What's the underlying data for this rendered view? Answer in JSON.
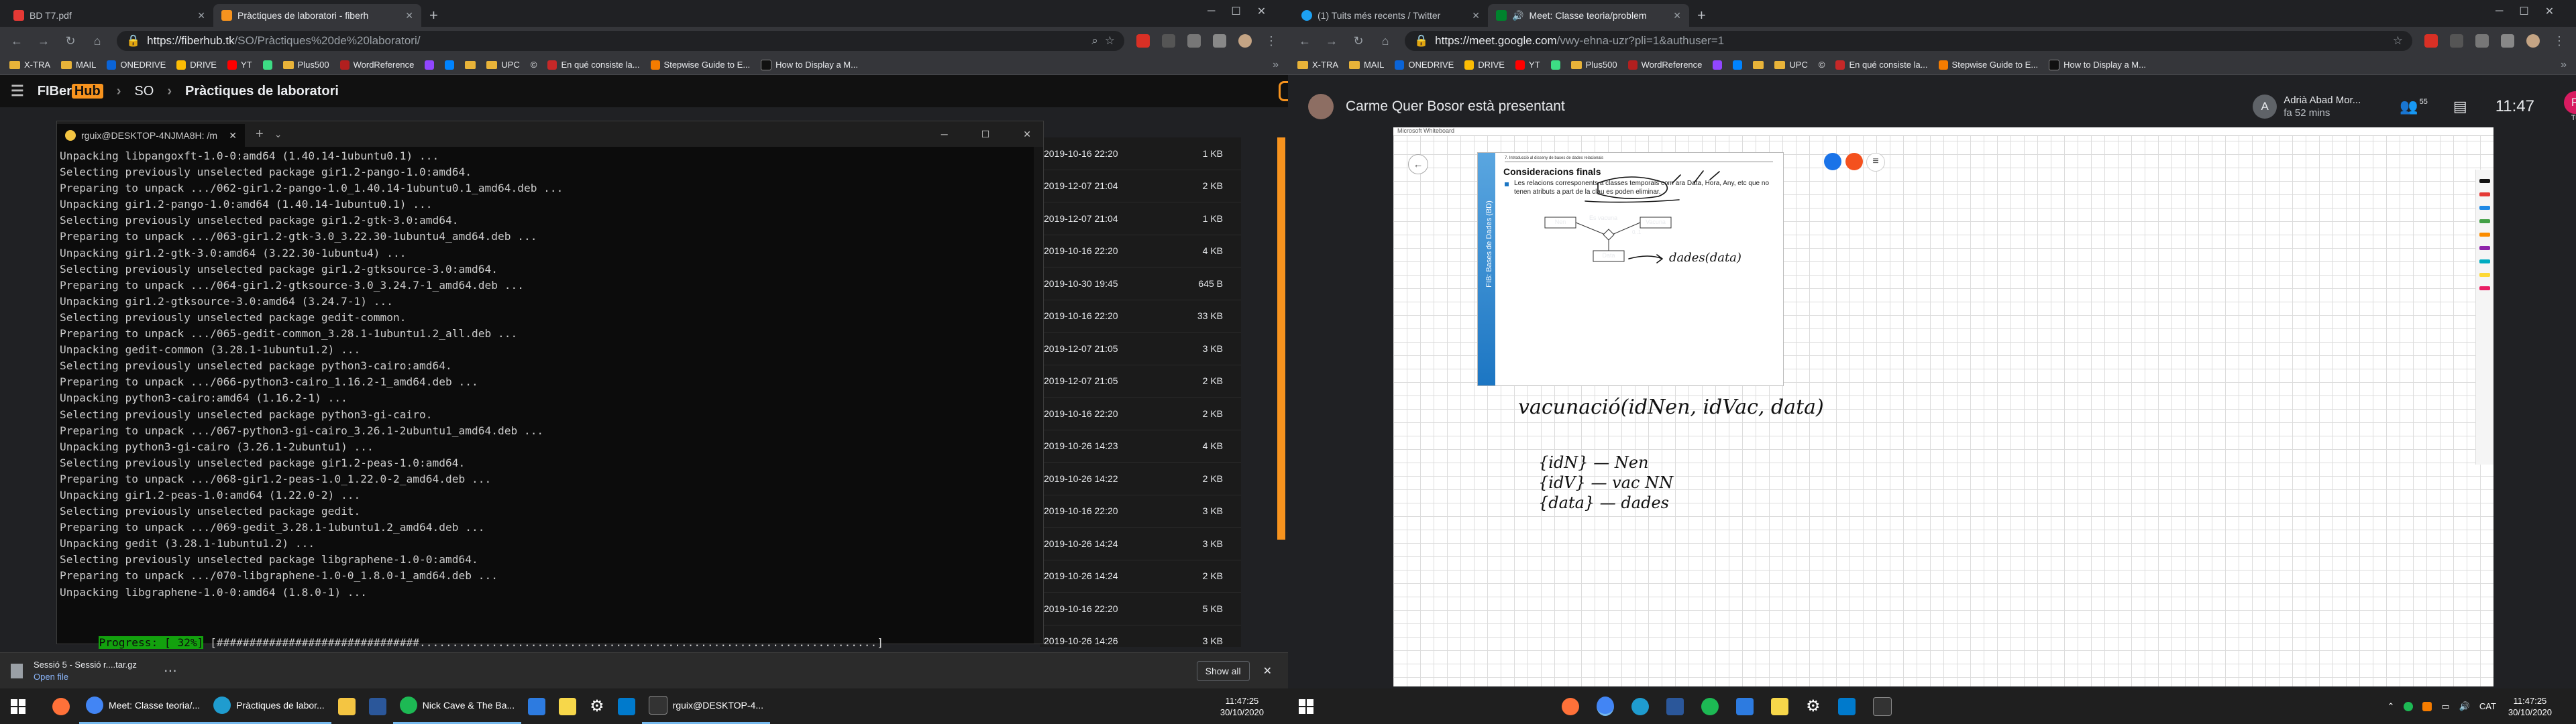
{
  "left_browser": {
    "tabs": [
      {
        "label": "BD T7.pdf",
        "color": "#e53935"
      },
      {
        "label": "Pràctiques de laboratori - fiberh",
        "color": "#f7931e"
      }
    ],
    "address": {
      "host": "https://fiberhub.tk",
      "path": "/SO/Pràctiques%20de%20laboratori/"
    },
    "bookmarks": [
      "X-TRA",
      "MAIL",
      "ONEDRIVE",
      "DRIVE",
      "YT",
      "",
      "Plus500",
      "WordReference",
      "",
      "",
      "UPC",
      "",
      "En qué consiste la...",
      "Stepwise Guide to E...",
      "How to Display a M..."
    ],
    "page_header": {
      "logo_a": "FIBer",
      "logo_b": "Hub",
      "crumb_1": "SO",
      "crumb_2": "Pràctiques de laboratori"
    },
    "file_rows": [
      {
        "date": "2019-10-16 22:20",
        "size": "1 KB"
      },
      {
        "date": "2019-12-07 21:04",
        "size": "2 KB"
      },
      {
        "date": "2019-12-07 21:04",
        "size": "1 KB"
      },
      {
        "date": "2019-10-16 22:20",
        "size": "4 KB"
      },
      {
        "date": "2019-10-30 19:45",
        "size": "645 B"
      },
      {
        "date": "2019-10-16 22:20",
        "size": "33 KB"
      },
      {
        "date": "2019-12-07 21:05",
        "size": "3 KB"
      },
      {
        "date": "2019-12-07 21:05",
        "size": "2 KB"
      },
      {
        "date": "2019-10-16 22:20",
        "size": "2 KB"
      },
      {
        "date": "2019-10-26 14:23",
        "size": "4 KB"
      },
      {
        "date": "2019-10-26 14:22",
        "size": "2 KB"
      },
      {
        "date": "2019-10-16 22:20",
        "size": "3 KB"
      },
      {
        "date": "2019-10-26 14:24",
        "size": "3 KB"
      },
      {
        "date": "2019-10-26 14:24",
        "size": "2 KB"
      },
      {
        "date": "2019-10-16 22:20",
        "size": "5 KB"
      },
      {
        "date": "2019-10-26 14:26",
        "size": "3 KB"
      }
    ]
  },
  "terminal": {
    "tab_title": "rguix@DESKTOP-4NJMA8H: /m",
    "lines": [
      "Unpacking libpangoxft-1.0-0:amd64 (1.40.14-1ubuntu0.1) ...",
      "Selecting previously unselected package gir1.2-pango-1.0:amd64.",
      "Preparing to unpack .../062-gir1.2-pango-1.0_1.40.14-1ubuntu0.1_amd64.deb ...",
      "Unpacking gir1.2-pango-1.0:amd64 (1.40.14-1ubuntu0.1) ...",
      "Selecting previously unselected package gir1.2-gtk-3.0:amd64.",
      "Preparing to unpack .../063-gir1.2-gtk-3.0_3.22.30-1ubuntu4_amd64.deb ...",
      "Unpacking gir1.2-gtk-3.0:amd64 (3.22.30-1ubuntu4) ...",
      "Selecting previously unselected package gir1.2-gtksource-3.0:amd64.",
      "Preparing to unpack .../064-gir1.2-gtksource-3.0_3.24.7-1_amd64.deb ...",
      "Unpacking gir1.2-gtksource-3.0:amd64 (3.24.7-1) ...",
      "Selecting previously unselected package gedit-common.",
      "Preparing to unpack .../065-gedit-common_3.28.1-1ubuntu1.2_all.deb ...",
      "Unpacking gedit-common (3.28.1-1ubuntu1.2) ...",
      "Selecting previously unselected package python3-cairo:amd64.",
      "Preparing to unpack .../066-python3-cairo_1.16.2-1_amd64.deb ...",
      "Unpacking python3-cairo:amd64 (1.16.2-1) ...",
      "Selecting previously unselected package python3-gi-cairo.",
      "Preparing to unpack .../067-python3-gi-cairo_3.26.1-2ubuntu1_amd64.deb ...",
      "Unpacking python3-gi-cairo (3.26.1-2ubuntu1) ...",
      "Selecting previously unselected package gir1.2-peas-1.0:amd64.",
      "Preparing to unpack .../068-gir1.2-peas-1.0_1.22.0-2_amd64.deb ...",
      "Unpacking gir1.2-peas-1.0:amd64 (1.22.0-2) ...",
      "Selecting previously unselected package gedit.",
      "Preparing to unpack .../069-gedit_3.28.1-1ubuntu1.2_amd64.deb ...",
      "Unpacking gedit (3.28.1-1ubuntu1.2) ...",
      "Selecting previously unselected package libgraphene-1.0-0:amd64.",
      "Preparing to unpack .../070-libgraphene-1.0-0_1.8.0-1_amd64.deb ...",
      "Unpacking libgraphene-1.0-0:amd64 (1.8.0-1) ..."
    ],
    "progress_label": "Progress: [ 32%]",
    "progress_bar": "[###############################......................................................................]",
    "progress_value": 0.32
  },
  "download": {
    "name": "Sessió 5 - Sessió r....tar.gz",
    "action": "Open file",
    "show_all": "Show all"
  },
  "right_browser": {
    "tabs": [
      {
        "label": "(1) Tuits més recents / Twitter",
        "color": "#1da1f2"
      },
      {
        "label": "Meet: Classe teoria/problem",
        "color": "#00832d"
      }
    ],
    "address": {
      "host": "https://meet.google.com",
      "path": "/vwy-ehna-uzr?pli=1&authuser=1"
    },
    "bookmarks": [
      "X-TRA",
      "MAIL",
      "ONEDRIVE",
      "DRIVE",
      "YT",
      "",
      "Plus500",
      "WordReference",
      "",
      "",
      "UPC",
      "",
      "En qué consiste la...",
      "Stepwise Guide to E...",
      "How to Display a M..."
    ]
  },
  "meet": {
    "presenter": "Carme Quer Bosor està presentant",
    "participant_name": "Adrià Abad Mor...",
    "participant_sub": "fa 52 mins",
    "participant_initial": "A",
    "people_count": "55",
    "time": "11:47",
    "user_initial": "R",
    "user_label": "Tu",
    "whiteboard_title": "Microsoft Whiteboard"
  },
  "slide": {
    "header": "7. Introducció al disseny de bases de dades relacionals",
    "title": "Consideracions finals",
    "bullet": "Les relacions corresponents a classes temporals com ara Data, Hora, Any, etc que no tenen atributs a part de la clau es poden eliminar.",
    "side_label": "FIB: Bases de Dades (BD)",
    "entity_nen": "Nen",
    "entity_vacuna": "Vacuna",
    "relation": "Es vacuna",
    "multiplicity": "0..1",
    "entity_data": "Data",
    "hand_1": "dades(data)",
    "hand_2": "vacunació(idNen, idVac, data)",
    "hand_3": "{idN} — Nen",
    "hand_4": "{idV} — vac NN",
    "hand_5": "{data} — dades"
  },
  "taskbar_left": {
    "apps": [
      "Meet: Classe teoria/...",
      "Pràctiques de labor...",
      "Nick Cave & The Ba...",
      "rguix@DESKTOP-4..."
    ],
    "time": "11:47:25",
    "date": "30/10/2020"
  },
  "taskbar_right": {
    "lang": "CAT",
    "time": "11:47:25",
    "date": "30/10/2020"
  }
}
